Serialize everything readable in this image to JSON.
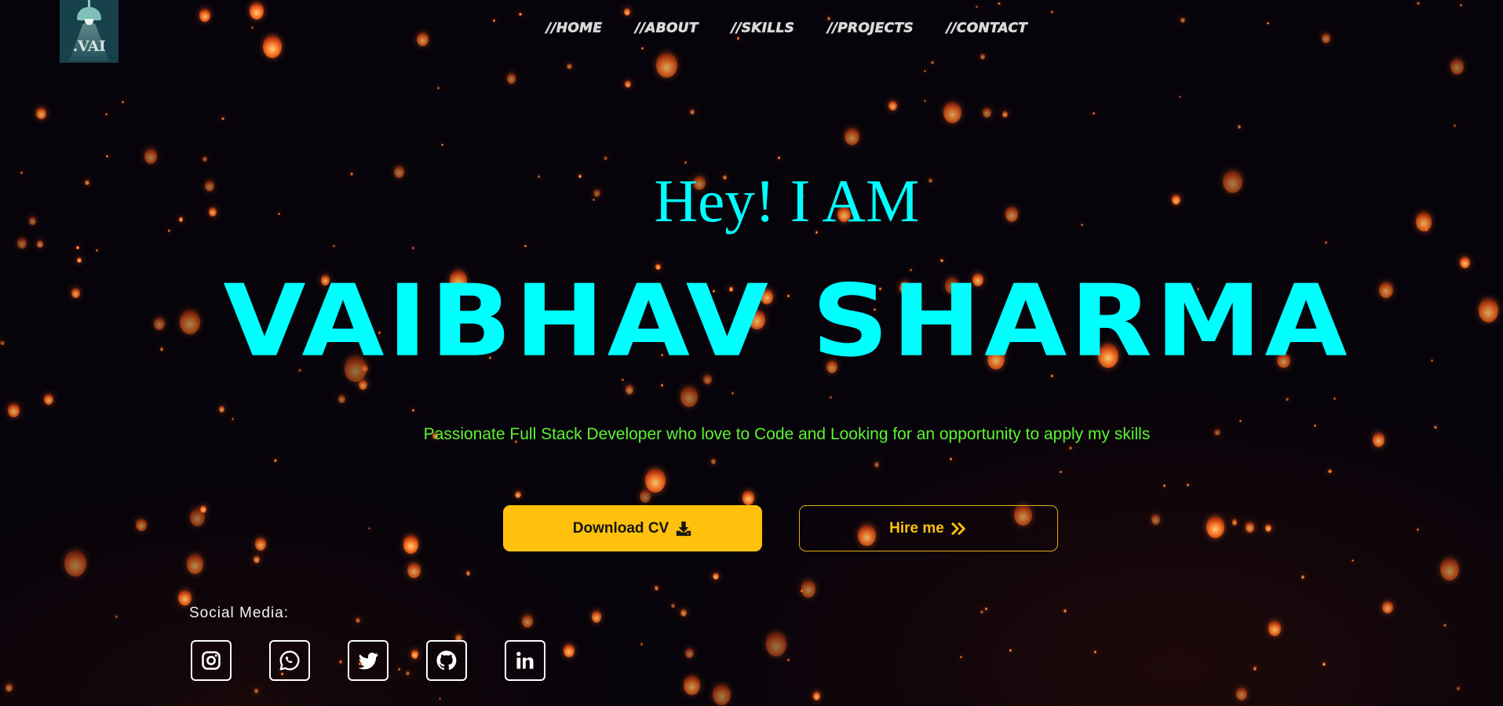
{
  "logo": {
    "text": ".VAI",
    "icon": "lamp-icon"
  },
  "nav": {
    "items": [
      {
        "label": "//HOME"
      },
      {
        "label": "//ABOUT"
      },
      {
        "label": "//SKILLS"
      },
      {
        "label": "//PROJECTS"
      },
      {
        "label": "//CONTACT"
      }
    ]
  },
  "hero": {
    "greeting": "Hey! I AM",
    "name": "VAIBHAV SHARMA",
    "tagline": "Passionate Full Stack Developer who love to Code and Looking for an opportunity to apply my skills"
  },
  "buttons": {
    "download_cv": {
      "label": "Download CV",
      "icon": "download-icon"
    },
    "hire_me": {
      "label": "Hire me",
      "icon": "double-chevron-right-icon"
    }
  },
  "social": {
    "label": "Social Media:",
    "icons": [
      "instagram-icon",
      "whatsapp-icon",
      "twitter-icon",
      "github-icon",
      "linkedin-icon"
    ]
  },
  "colors": {
    "accent_cyan": "#00ffff",
    "tagline_green": "#5cf531",
    "button_yellow": "#ffc10b",
    "background": "#07030a"
  }
}
